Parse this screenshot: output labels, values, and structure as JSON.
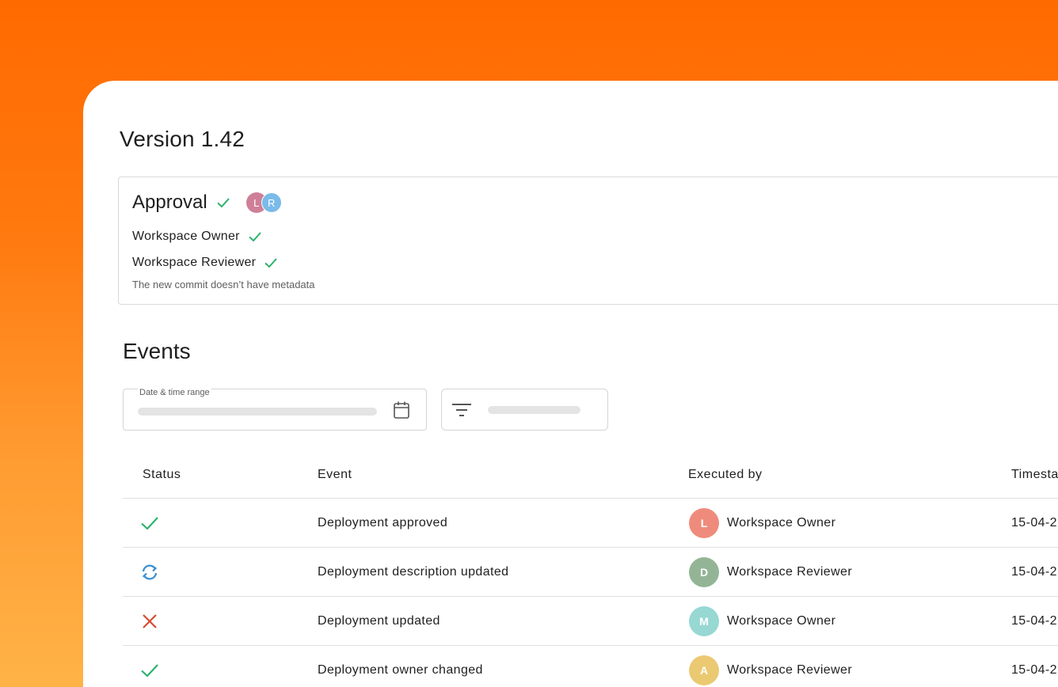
{
  "page": {
    "title": "Version 1.42"
  },
  "approval": {
    "title": "Approval",
    "avatars": [
      {
        "initial": "L",
        "color": "#cf7f98"
      },
      {
        "initial": "R",
        "color": "#7bbbea"
      }
    ],
    "approvers": [
      {
        "name": "Workspace Owner",
        "status": "approved"
      },
      {
        "name": "Workspace Reviewer",
        "status": "approved"
      }
    ],
    "note": "The new commit doesn’t have metadata"
  },
  "events": {
    "title": "Events",
    "date_field_label": "Date & time range",
    "columns": {
      "status": "Status",
      "event": "Event",
      "executed_by": "Executed by",
      "timestamp": "Timesta"
    },
    "rows": [
      {
        "status_icon": "check-icon",
        "event": "Deployment approved",
        "avatar_initial": "L",
        "avatar_color": "#ef8b7c",
        "executed_by": "Workspace Owner",
        "timestamp": "15-04-2"
      },
      {
        "status_icon": "refresh-icon",
        "event": "Deployment description updated",
        "avatar_initial": "D",
        "avatar_color": "#93b596",
        "executed_by": "Workspace Reviewer",
        "timestamp": "15-04-2"
      },
      {
        "status_icon": "close-icon",
        "event": "Deployment updated",
        "avatar_initial": "M",
        "avatar_color": "#97d8d3",
        "executed_by": "Workspace Owner",
        "timestamp": "15-04-2"
      },
      {
        "status_icon": "check-icon",
        "event": "Deployment owner changed",
        "avatar_initial": "A",
        "avatar_color": "#ebc973",
        "executed_by": "Workspace Reviewer",
        "timestamp": "15-04-2"
      }
    ]
  },
  "colors": {
    "accent_orange": "#ff6a00",
    "success_green": "#2bb26b",
    "error_red": "#d64a2f",
    "info_blue": "#3f8fcf"
  }
}
